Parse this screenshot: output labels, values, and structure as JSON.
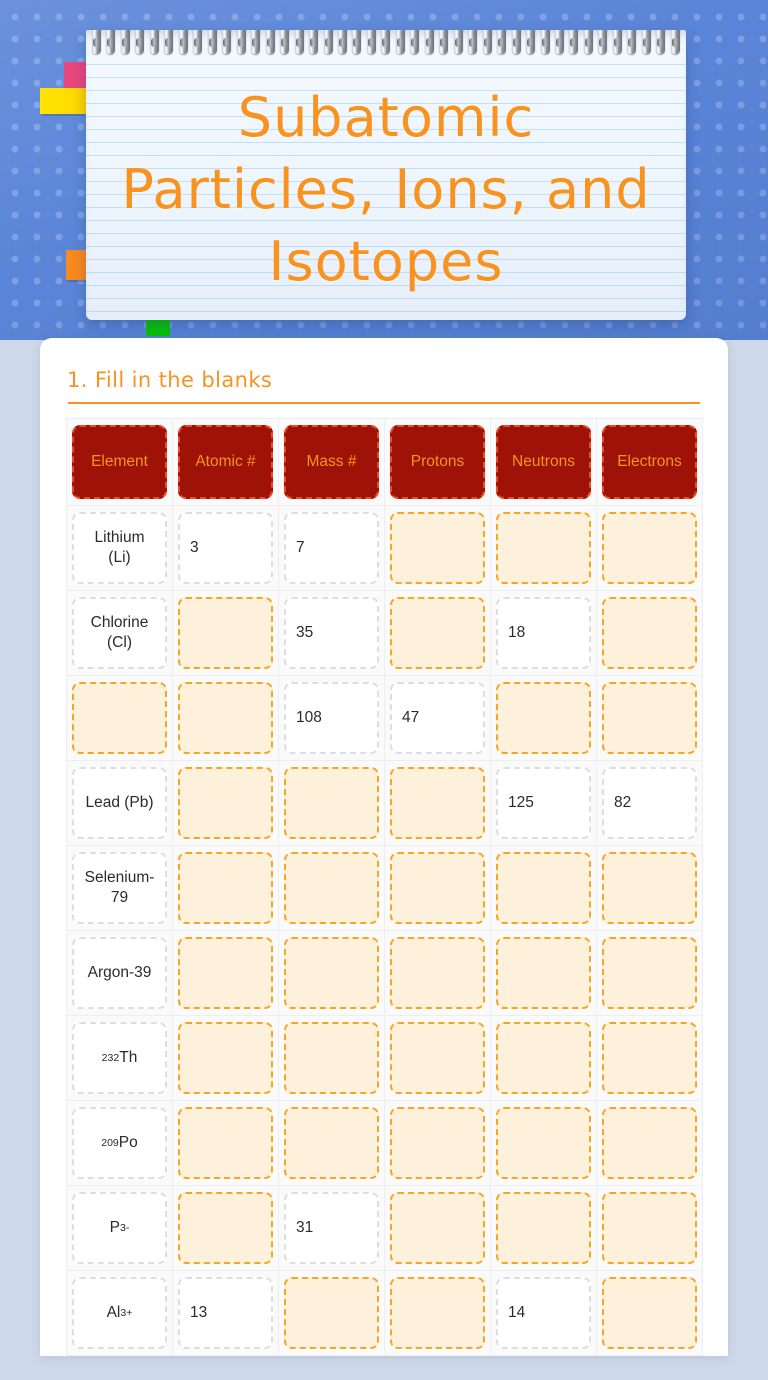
{
  "banner": {
    "title": "Subatomic Particles, Ions, and Isotopes",
    "accent_color": "#f7931e",
    "background_color": "#5a85d8",
    "tabs": [
      {
        "name": "pink-tab",
        "color": "#e8477e"
      },
      {
        "name": "yellow-tab",
        "color": "#ffe600"
      },
      {
        "name": "orange-tab",
        "color": "#f98a1d"
      },
      {
        "name": "green-tab",
        "color": "#0ac10a"
      }
    ]
  },
  "section": {
    "title": "1. Fill in the blanks"
  },
  "table": {
    "headers": [
      "Element",
      "Atomic #",
      "Mass #",
      "Protons",
      "Neutrons",
      "Electrons"
    ],
    "header_bg": "#9e1208",
    "header_border": "#f04a24",
    "header_text_color": "#f7931e",
    "blank_bg": "#fdf1dc",
    "blank_border": "#f5a623",
    "filled_bg": "#ffffff",
    "filled_border": "#dcdee0",
    "rows": [
      {
        "element": "Lithium (Li)",
        "element_filled": true,
        "atomic": "3",
        "mass": "7",
        "protons": "",
        "neutrons": "",
        "electrons": ""
      },
      {
        "element": "Chlorine (Cl)",
        "element_filled": true,
        "atomic": "",
        "mass": "35",
        "protons": "",
        "neutrons": "18",
        "electrons": ""
      },
      {
        "element": "",
        "element_filled": false,
        "atomic": "",
        "mass": "108",
        "protons": "47",
        "neutrons": "",
        "electrons": ""
      },
      {
        "element": "Lead (Pb)",
        "element_filled": true,
        "atomic": "",
        "mass": "",
        "protons": "",
        "neutrons": "125",
        "electrons": "82"
      },
      {
        "element": "Selenium-79",
        "element_filled": true,
        "atomic": "",
        "mass": "",
        "protons": "",
        "neutrons": "",
        "electrons": ""
      },
      {
        "element": "Argon-39",
        "element_filled": true,
        "atomic": "",
        "mass": "",
        "protons": "",
        "neutrons": "",
        "electrons": ""
      },
      {
        "element": "232Th",
        "element_html": "<sup>232</sup>Th",
        "element_filled": true,
        "atomic": "",
        "mass": "",
        "protons": "",
        "neutrons": "",
        "electrons": ""
      },
      {
        "element": "209Po",
        "element_html": "<sup>209</sup>Po",
        "element_filled": true,
        "atomic": "",
        "mass": "",
        "protons": "",
        "neutrons": "",
        "electrons": ""
      },
      {
        "element": "P3-",
        "element_html": "P<sup>3-</sup>",
        "element_filled": true,
        "atomic": "",
        "mass": "31",
        "protons": "",
        "neutrons": "",
        "electrons": ""
      },
      {
        "element": "Al3+",
        "element_html": "Al<sup>3+</sup>",
        "element_filled": true,
        "atomic": "13",
        "mass": "",
        "protons": "",
        "neutrons": "14",
        "electrons": ""
      }
    ]
  }
}
